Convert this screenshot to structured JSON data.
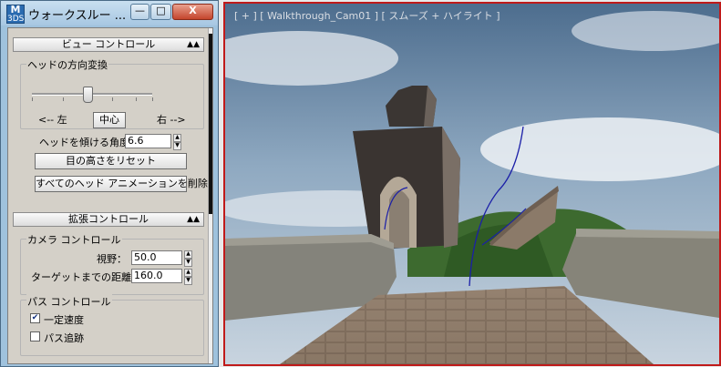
{
  "dialog": {
    "title": "ウォークスルー ...",
    "app_icon": {
      "top": "M",
      "bottom": "3DS"
    },
    "window_controls": {
      "minimize": "—",
      "maximize": "□",
      "close": "X"
    }
  },
  "view_control": {
    "header": "ビュー コントロール",
    "head_turn": {
      "group_label": "ヘッドの方向変換",
      "slider_value": 0.46,
      "left_label": "<-- 左",
      "center_button": "中心",
      "right_label": "右 -->"
    },
    "tilt_label": "ヘッドを傾ける角度",
    "tilt_value": "6.6",
    "reset_eye_button": "目の高さをリセット",
    "delete_head_anim_button": "すべてのヘッド アニメーションを削除"
  },
  "advanced_control": {
    "header": "拡張コントロール",
    "camera": {
      "group_label": "カメラ コントロール",
      "fov_label": "視野：",
      "fov_value": "50.0",
      "target_label": "ターゲットまでの距離：",
      "target_value": "160.0"
    },
    "path": {
      "group_label": "パス コントロール",
      "constant_speed_label": "一定速度",
      "constant_speed_checked": true,
      "follow_path_label": "パス追跡",
      "follow_path_checked": false
    }
  },
  "viewport": {
    "label": "[ + ] [ Walkthrough_Cam01 ] [ スムーズ + ハイライト ]"
  },
  "colors": {
    "viewport_border": "#c01a1a",
    "path_spline": "#1b1fa8",
    "sky": "#7d9bb7",
    "hill": "#3d6a2f"
  }
}
